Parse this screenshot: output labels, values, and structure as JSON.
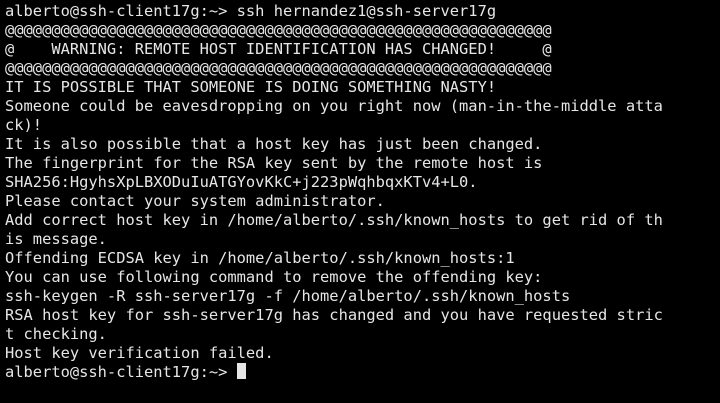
{
  "terminal": {
    "colors": {
      "background": "#000000",
      "foreground": "#e6e6e6",
      "cursor": "#e6e6e6"
    },
    "lines": [
      "alberto@ssh-client17g:~> ssh hernandez1@ssh-server17g",
      "@@@@@@@@@@@@@@@@@@@@@@@@@@@@@@@@@@@@@@@@@@@@@@@@@@@@@@@@@@@",
      "@    WARNING: REMOTE HOST IDENTIFICATION HAS CHANGED!     @",
      "@@@@@@@@@@@@@@@@@@@@@@@@@@@@@@@@@@@@@@@@@@@@@@@@@@@@@@@@@@@",
      "IT IS POSSIBLE THAT SOMEONE IS DOING SOMETHING NASTY!",
      "Someone could be eavesdropping on you right now (man-in-the-middle atta",
      "ck)!",
      "It is also possible that a host key has just been changed.",
      "The fingerprint for the RSA key sent by the remote host is",
      "SHA256:HgyhsXpLBXODuIuATGYovKkC+j223pWqhbqxKTv4+L0.",
      "Please contact your system administrator.",
      "Add correct host key in /home/alberto/.ssh/known_hosts to get rid of th",
      "is message.",
      "Offending ECDSA key in /home/alberto/.ssh/known_hosts:1",
      "You can use following command to remove the offending key:",
      "ssh-keygen -R ssh-server17g -f /home/alberto/.ssh/known_hosts",
      "RSA host key for ssh-server17g has changed and you have requested stric",
      "t checking.",
      "Host key verification failed."
    ],
    "prompt": "alberto@ssh-client17g:~> "
  }
}
